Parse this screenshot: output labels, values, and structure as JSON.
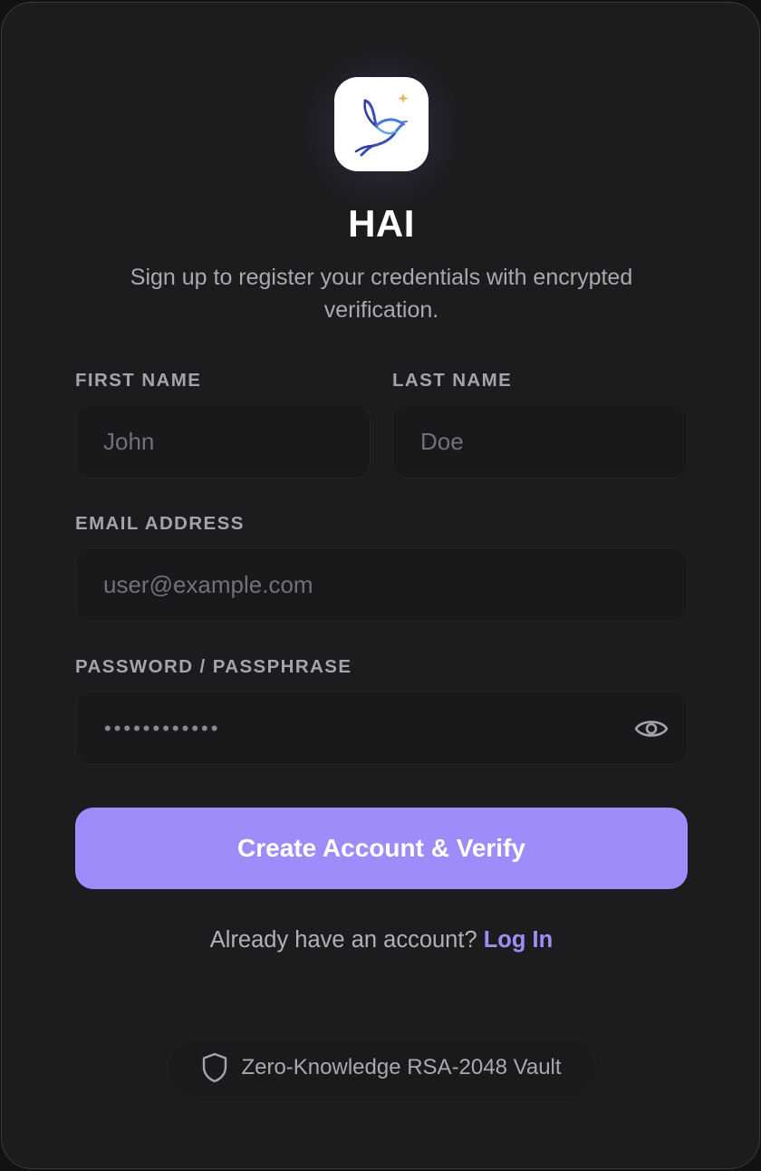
{
  "app": {
    "name": "HAI",
    "subtitle": "Sign up to register your credentials with encrypted verification.",
    "logo_icon": "dove-icon"
  },
  "form": {
    "first_name": {
      "label": "FIRST NAME",
      "placeholder": "John",
      "value": ""
    },
    "last_name": {
      "label": "LAST NAME",
      "placeholder": "Doe",
      "value": ""
    },
    "email": {
      "label": "EMAIL ADDRESS",
      "placeholder": "user@example.com",
      "value": ""
    },
    "password": {
      "label": "PASSWORD / PASSPHRASE",
      "masked_value": "••••••••••••",
      "toggle_icon": "eye-icon"
    },
    "submit_label": "Create Account & Verify"
  },
  "login": {
    "prompt": "Already have an account?",
    "link_label": "Log In"
  },
  "footer": {
    "badge_icon": "shield-icon",
    "badge_text": "Zero-Knowledge RSA-2048 Vault"
  },
  "colors": {
    "background": "#1c1c1e",
    "accent": "#9d8cf9",
    "link": "#a08df8",
    "field_bg": "#19191b"
  }
}
